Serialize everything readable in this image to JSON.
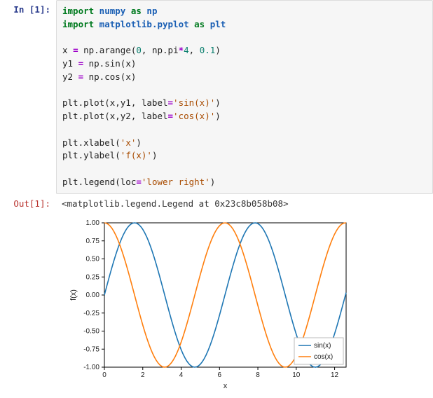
{
  "in_prompt": "In [1]:",
  "out_prompt": "Out[1]:",
  "code": {
    "l01a": "import",
    "l01b": " numpy ",
    "l01c": "as",
    "l01d": " np",
    "l02a": "import",
    "l02b": " matplotlib.pyplot ",
    "l02c": "as",
    "l02d": " plt",
    "l04a": "x ",
    "l04b": "=",
    "l04c": " np.arange(",
    "l04d": "0",
    "l04e": ", np.pi",
    "l04f": "*",
    "l04g": "4",
    "l04h": ", ",
    "l04i": "0.1",
    "l04j": ")",
    "l05a": "y1 ",
    "l05b": "=",
    "l05c": " np.sin(x)",
    "l06a": "y2 ",
    "l06b": "=",
    "l06c": " np.cos(x)",
    "l08a": "plt.plot(x,y1, label",
    "l08b": "=",
    "l08c": "'sin(x)'",
    "l08d": ")",
    "l09a": "plt.plot(x,y2, label",
    "l09b": "=",
    "l09c": "'cos(x)'",
    "l09d": ")",
    "l11a": "plt.xlabel(",
    "l11b": "'x'",
    "l11c": ")",
    "l12a": "plt.ylabel(",
    "l12b": "'f(x)'",
    "l12c": ")",
    "l14a": "plt.legend(loc",
    "l14b": "=",
    "l14c": "'lower right'",
    "l14d": ")"
  },
  "output_text": "<matplotlib.legend.Legend at 0x23c8b058b08>",
  "chart_data": {
    "type": "line",
    "xlabel": "x",
    "ylabel": "f(x)",
    "xlim": [
      0,
      12.6
    ],
    "ylim": [
      -1.0,
      1.0
    ],
    "x_ticks": [
      0,
      2,
      4,
      6,
      8,
      10,
      12
    ],
    "y_ticks": [
      -1.0,
      -0.75,
      -0.5,
      -0.25,
      0.0,
      0.25,
      0.5,
      0.75,
      1.0
    ],
    "x_step": 0.1,
    "series": [
      {
        "name": "sin(x)",
        "fn": "sin",
        "color": "#1f77b4"
      },
      {
        "name": "cos(x)",
        "fn": "cos",
        "color": "#ff7f0e"
      }
    ],
    "legend": {
      "position": "lower right",
      "entries": [
        "sin(x)",
        "cos(x)"
      ]
    }
  }
}
